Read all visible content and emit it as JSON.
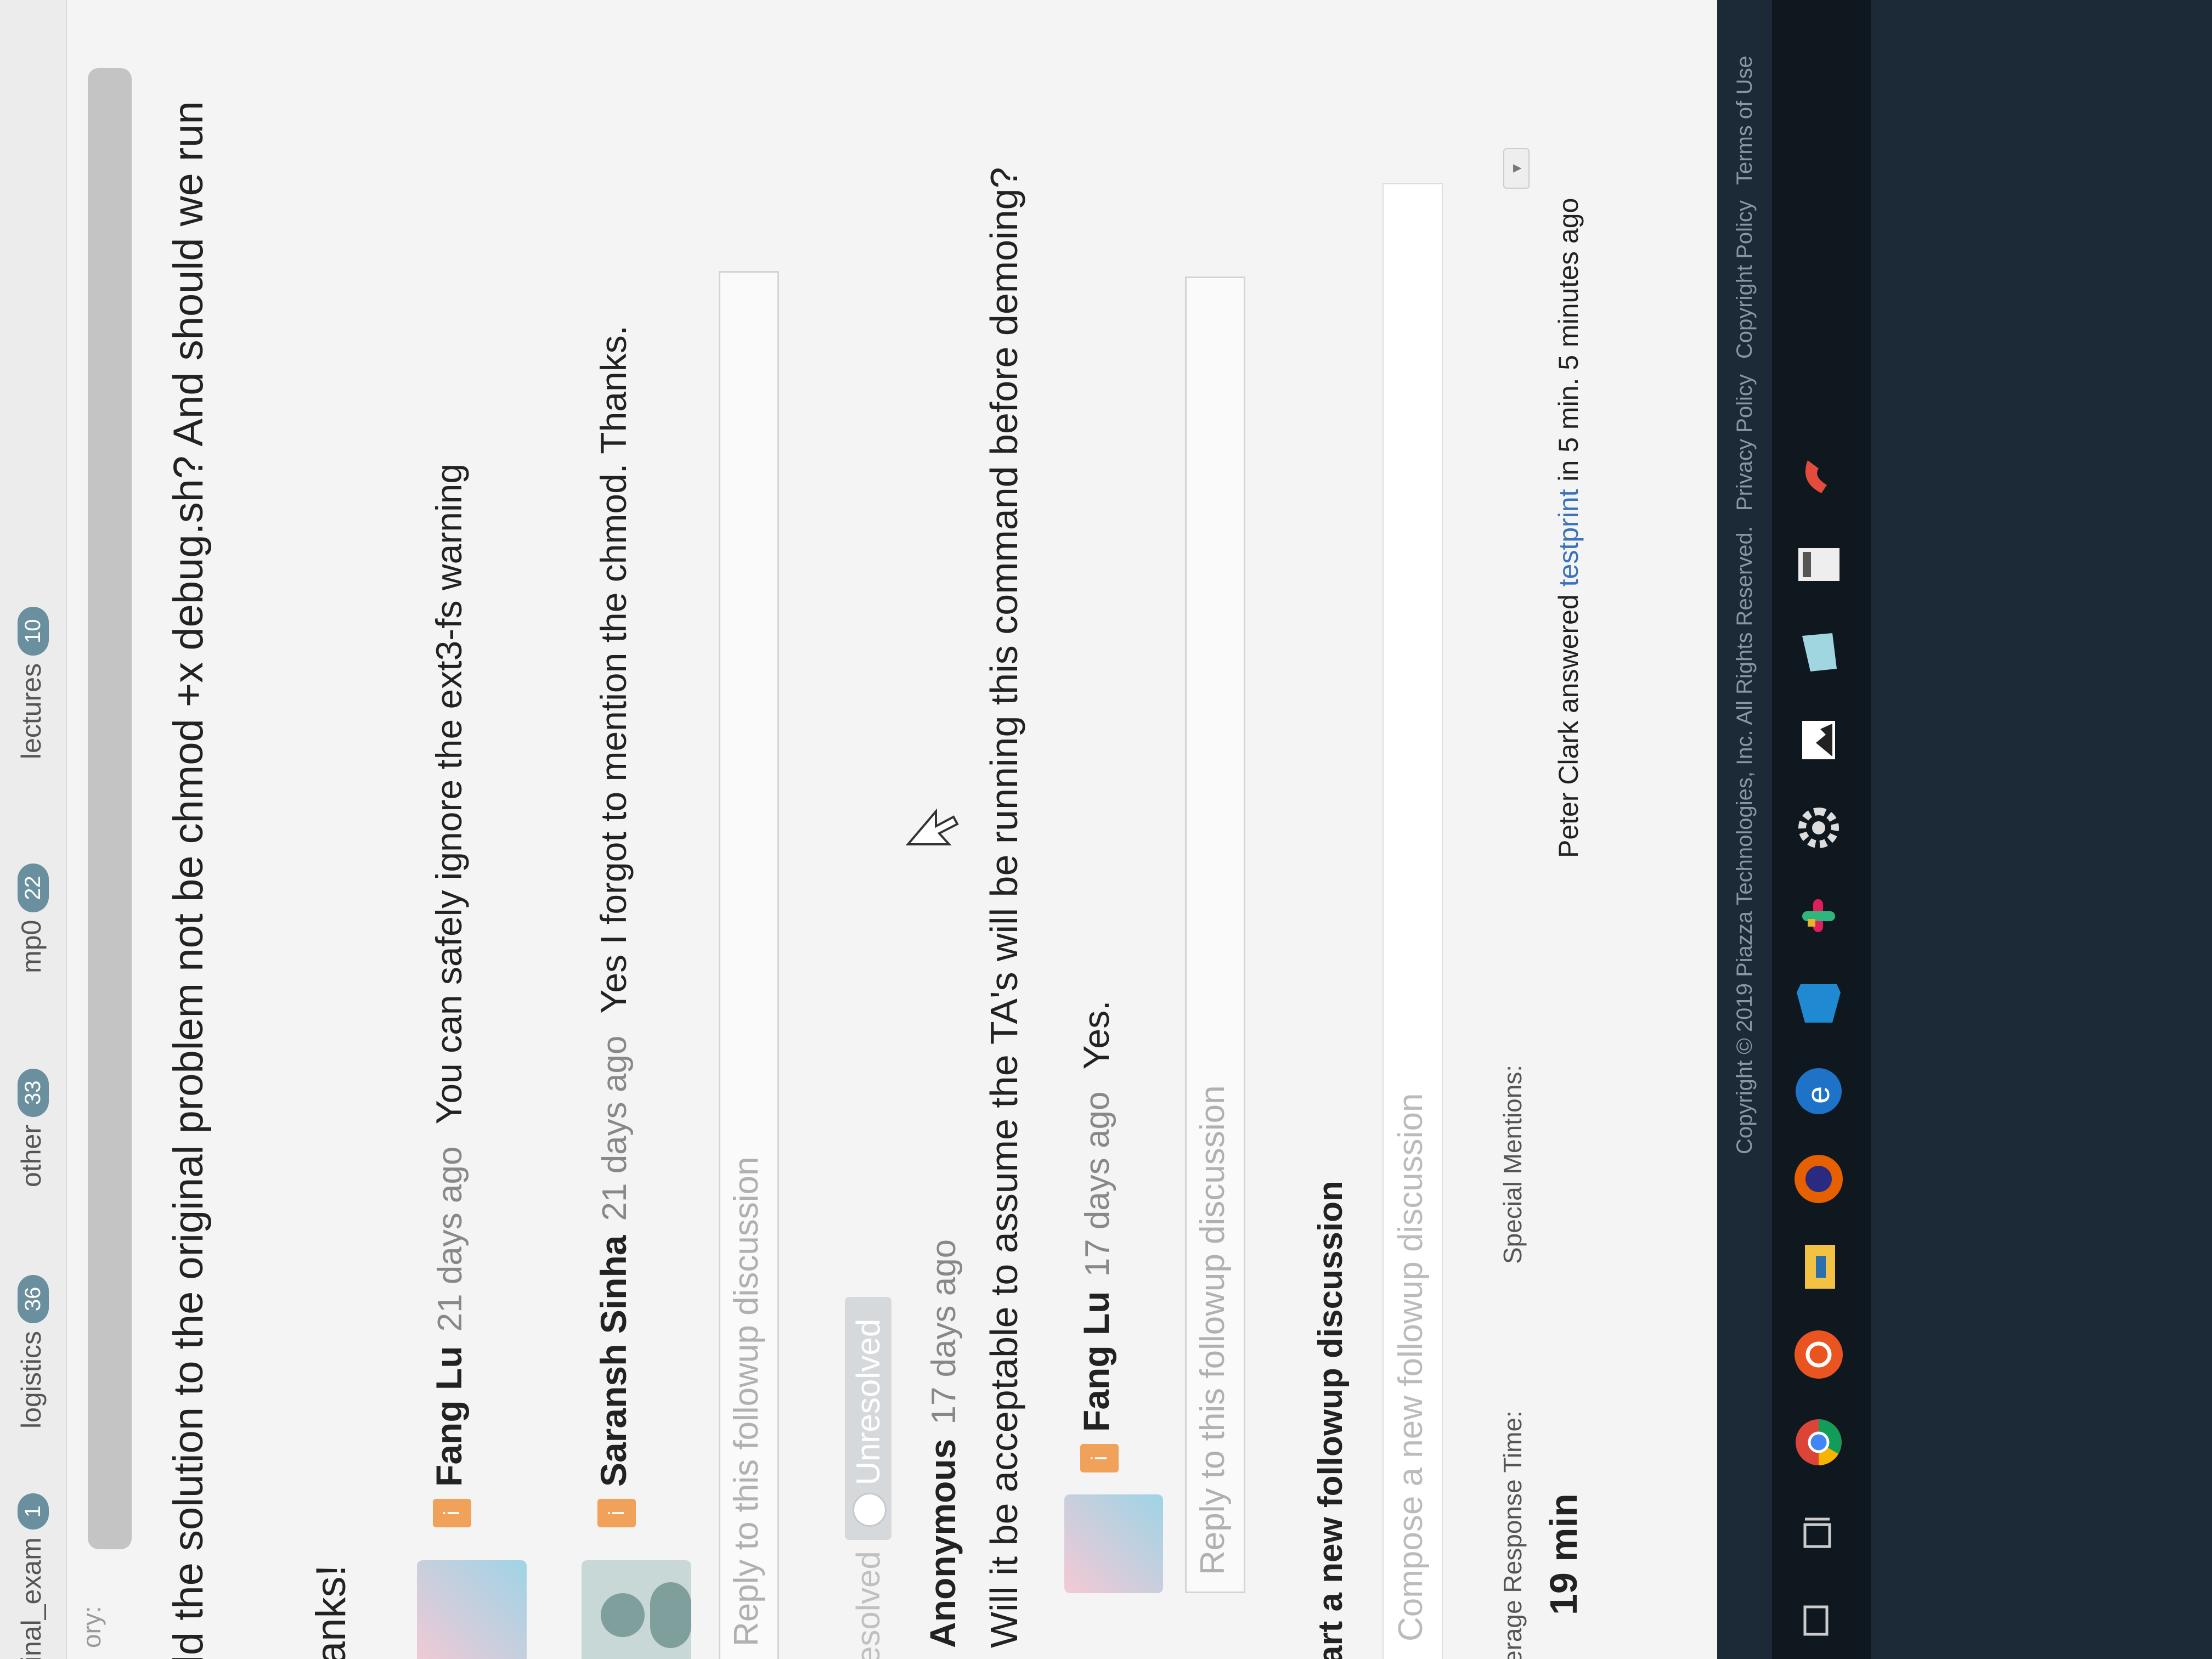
{
  "tabs": [
    {
      "label": "final_exam",
      "count": "1"
    },
    {
      "label": "logistics",
      "count": "36"
    },
    {
      "label": "other",
      "count": "33"
    },
    {
      "label": "mp0",
      "count": "22"
    },
    {
      "label": "lectures",
      "count": "10"
    }
  ],
  "summary_label": "ory:",
  "question_text": "ld the solution to the original problem not be chmod +x debug.sh? And should we run",
  "thanks_text": "anks!",
  "followup1": {
    "replies": [
      {
        "author": "Fang Lu",
        "when": "21 days ago",
        "text": "You can safely ignore the ext3-fs warning"
      },
      {
        "author": "Saransh Sinha",
        "when": "21 days ago",
        "text": "Yes I forgot to mention the chmod. Thanks."
      }
    ],
    "reply_placeholder": "Reply to this followup discussion"
  },
  "resolution": {
    "resolved": "esolved",
    "unresolved": "Unresolved"
  },
  "followup2": {
    "author": "Anonymous",
    "when": "17 days ago",
    "text": "Will it be acceptable to assume the TA's will be running this command before demoing?",
    "reply": {
      "author": "Fang Lu",
      "when": "17 days ago",
      "text": "Yes."
    },
    "reply_placeholder": "Reply to this followup discussion"
  },
  "new_followup": {
    "title": "art a new followup discussion",
    "placeholder": "Compose a new followup discussion"
  },
  "stats": {
    "response_time_label": "erage Response Time:",
    "response_time_value": "19 min",
    "mentions_label": "Special Mentions:",
    "mention_prefix": "Peter Clark answered ",
    "mention_link": "testprint",
    "mention_suffix": " in 5 min. 5 minutes ago"
  },
  "footer": {
    "copyright": "Copyright © 2019 Piazza Technologies, Inc. All Rights Reserved.",
    "privacy": "Privacy Policy",
    "copyright_policy": "Copyright Policy",
    "terms": "Terms of Use"
  },
  "taskbar_icons": [
    "search-icon",
    "task-view-icon",
    "chrome-icon",
    "ubuntu-icon",
    "file-explorer-icon",
    "firefox-icon",
    "edge-icon",
    "vscode-icon",
    "slack-icon",
    "settings-icon",
    "photos-icon",
    "folder-icon",
    "calculator-icon",
    "python-icon"
  ]
}
